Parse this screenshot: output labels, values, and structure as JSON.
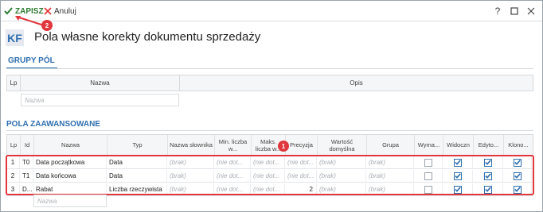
{
  "toolbar": {
    "save_label": "ZAPISZ",
    "cancel_label": "Anuluj",
    "help": "?"
  },
  "header": {
    "badge": "KF",
    "title": "Pola własne korekty dokumentu sprzedaży"
  },
  "groups": {
    "title": "GRUPY PÓL",
    "columns": [
      "Lp",
      "Nazwa",
      "Opis"
    ],
    "name_placeholder": "Nazwa"
  },
  "advanced": {
    "title": "POLA ZAAWANSOWANE",
    "columns": [
      "Lp",
      "Id",
      "Nazwa",
      "Typ",
      "Nazwa słownika",
      "Min. liczba w...",
      "Maks. liczba w...",
      "Precyzja",
      "Wartość domyślna",
      "Grupa",
      "Wyma...",
      "Widoczn",
      "Edyto...",
      "Klono..."
    ],
    "rows": [
      {
        "lp": "1",
        "id": "T0",
        "name": "Data początkowa",
        "type": "Data",
        "dict": "(brak)",
        "min": "(nie dot...",
        "max": "(nie dot...",
        "prec": "(nie dot...",
        "default": "(brak)",
        "group": "(brak)",
        "req": false,
        "visible": true,
        "edit": true,
        "clone": true
      },
      {
        "lp": "2",
        "id": "T1",
        "name": "Data końcowa",
        "type": "Data",
        "dict": "(brak)",
        "min": "(nie dot...",
        "max": "(nie dot...",
        "prec": "(nie dot...",
        "default": "(brak)",
        "group": "(brak)",
        "req": false,
        "visible": true,
        "edit": true,
        "clone": true
      },
      {
        "lp": "3",
        "id": "D...",
        "name": "Rabat",
        "type": "Liczba rzeczywista",
        "dict": "(brak)",
        "min": "(nie dot...",
        "max": "(nie dot...",
        "prec": "2",
        "default": "(brak)",
        "group": "(brak)",
        "req": false,
        "visible": true,
        "edit": true,
        "clone": true
      }
    ],
    "name_placeholder": "Nazwa"
  },
  "annotations": {
    "badge1": "1",
    "badge2": "2",
    "accent": "#e0383c"
  },
  "colors": {
    "brand": "#2f6fb0",
    "save": "#2e7d32"
  }
}
